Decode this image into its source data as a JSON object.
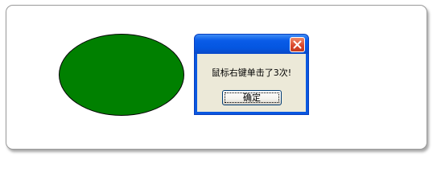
{
  "canvas": {
    "shape_fill": "#008000",
    "shape_stroke": "#000000"
  },
  "dialog": {
    "title": "",
    "message": "鼠标右键单击了3次!",
    "ok_label": "确定",
    "close_icon": "close-x-icon",
    "titlebar_color": "#0a58e0",
    "close_color": "#d9452a",
    "body_color": "#ece9d8"
  }
}
